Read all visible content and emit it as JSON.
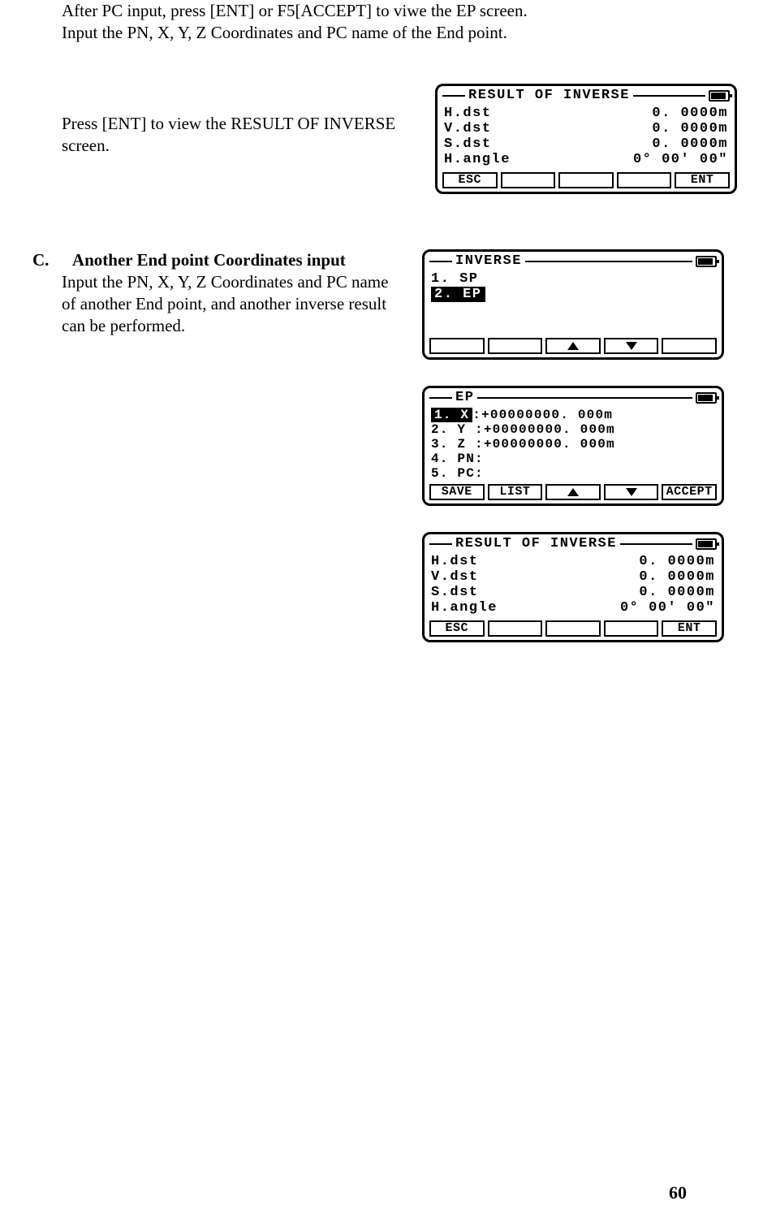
{
  "intro": {
    "line1": "After PC input,  press [ENT] or F5[ACCEPT] to viwe the EP screen.",
    "line2": "Input the PN, X, Y, Z Coordinates and PC name of the End point."
  },
  "step_ent": "Press [ENT] to view the RESULT OF INVERSE screen.",
  "section_c": {
    "label": "C.",
    "title": "Another End point Coordinates input",
    "body": "Input the PN, X, Y, Z Coordinates and PC name of another End point, and another inverse result can be performed."
  },
  "screens": {
    "result1": {
      "title": "RESULT OF INVERSE",
      "rows": [
        {
          "label": "H.dst",
          "value": "0. 0000m"
        },
        {
          "label": "V.dst",
          "value": "0. 0000m"
        },
        {
          "label": "S.dst",
          "value": "0. 0000m"
        },
        {
          "label": "H.angle",
          "value": "0° 00′ 00″"
        }
      ],
      "fkeys": [
        "ESC",
        "",
        "",
        "",
        "ENT"
      ]
    },
    "inverse": {
      "title": "INVERSE",
      "items": [
        {
          "text": "1. SP",
          "selected": false
        },
        {
          "text": "2. EP",
          "selected": true
        }
      ],
      "fkeys": [
        "",
        "",
        "↑",
        "↓",
        ""
      ]
    },
    "ep": {
      "title": "EP",
      "rows": [
        {
          "label": "1. X",
          "selected": true,
          "value": ":+00000000. 000m"
        },
        {
          "label": "2. Y",
          "selected": false,
          "value": ":+00000000. 000m"
        },
        {
          "label": "3. Z",
          "selected": false,
          "value": ":+00000000. 000m"
        },
        {
          "label": "4. PN",
          "selected": false,
          "value": ":"
        },
        {
          "label": "5. PC",
          "selected": false,
          "value": ":"
        }
      ],
      "fkeys": [
        "SAVE",
        "LIST",
        "↑",
        "↓",
        "ACCEPT"
      ]
    },
    "result2": {
      "title": "RESULT OF INVERSE",
      "rows": [
        {
          "label": "H.dst",
          "value": "0. 0000m"
        },
        {
          "label": "V.dst",
          "value": "0. 0000m"
        },
        {
          "label": "S.dst",
          "value": "0. 0000m"
        },
        {
          "label": "H.angle",
          "value": "0° 00′ 00″"
        }
      ],
      "fkeys": [
        "ESC",
        "",
        "",
        "",
        "ENT"
      ]
    }
  },
  "page_number": "60"
}
